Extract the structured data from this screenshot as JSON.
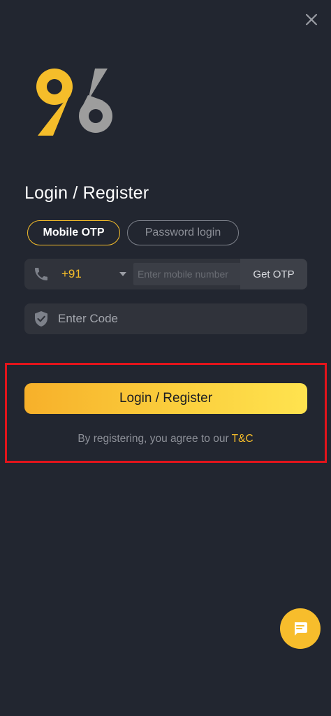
{
  "header": {
    "close_icon": "close-icon",
    "logo_text": "96"
  },
  "login": {
    "title": "Login / Register",
    "tabs": [
      {
        "label": "Mobile OTP",
        "active": true
      },
      {
        "label": "Password login",
        "active": false
      }
    ],
    "phone": {
      "icon": "phone-icon",
      "country_code": "+91",
      "placeholder": "Enter mobile number",
      "get_otp_label": "Get OTP"
    },
    "code": {
      "icon": "shield-check-icon",
      "placeholder": "Enter Code"
    },
    "submit_label": "Login / Register",
    "terms_prefix": "By registering, you agree to our ",
    "terms_link": "T&C"
  },
  "chat": {
    "icon": "chat-bubble-icon"
  },
  "colors": {
    "background": "#222630",
    "accent": "#f5bd2a",
    "field_bg": "#30333b",
    "highlight": "#e3141b"
  }
}
